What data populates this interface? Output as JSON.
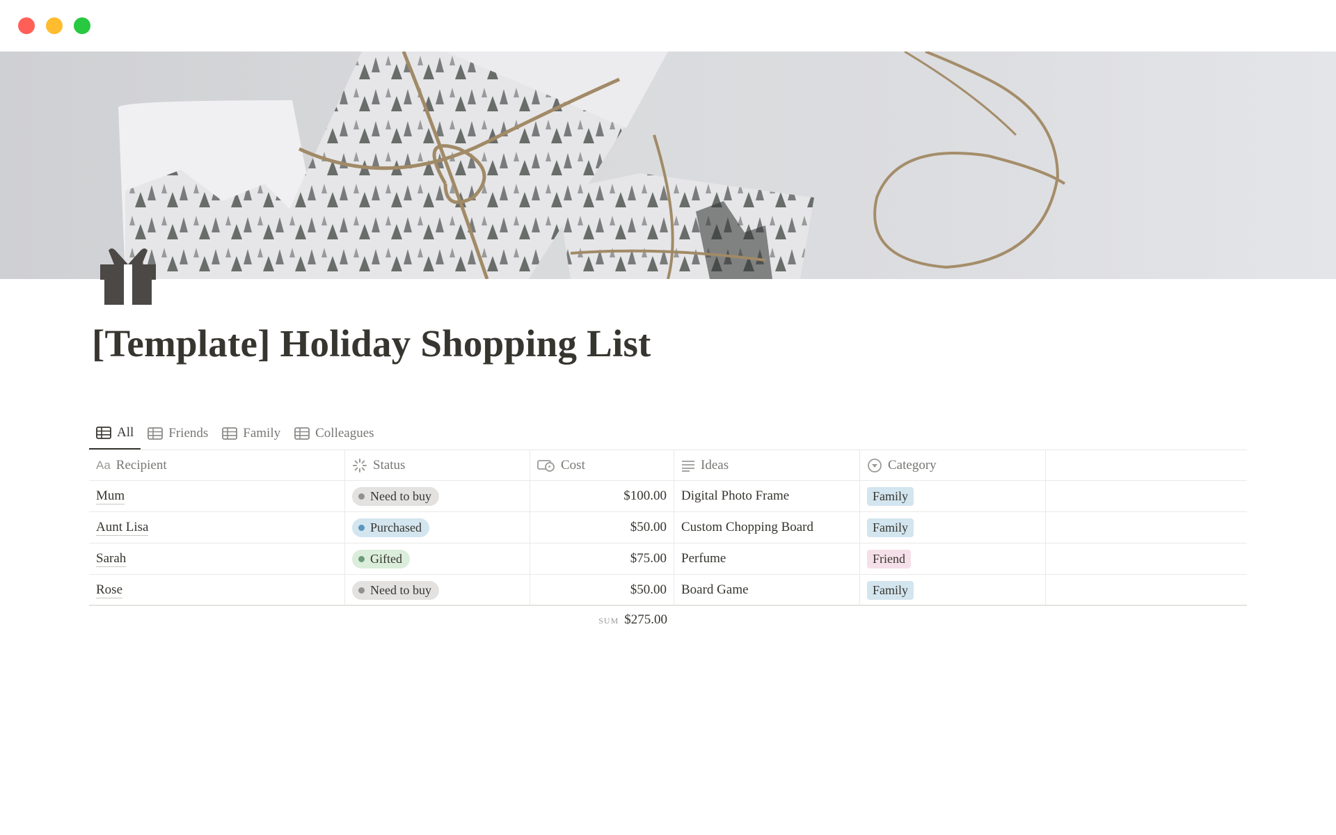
{
  "window": {
    "controls": [
      "close",
      "minimize",
      "maximize"
    ]
  },
  "page": {
    "title": "[Template] Holiday Shopping List",
    "icon": "gift-icon"
  },
  "tabs": [
    {
      "label": "All",
      "icon": "table-icon",
      "active": true
    },
    {
      "label": "Friends",
      "icon": "table-icon",
      "active": false
    },
    {
      "label": "Family",
      "icon": "table-icon",
      "active": false
    },
    {
      "label": "Colleagues",
      "icon": "table-icon",
      "active": false
    }
  ],
  "table": {
    "columns": [
      {
        "label": "Recipient",
        "icon": "text-property-icon"
      },
      {
        "label": "Status",
        "icon": "status-property-icon"
      },
      {
        "label": "Cost",
        "icon": "number-property-icon"
      },
      {
        "label": "Ideas",
        "icon": "list-property-icon"
      },
      {
        "label": "Category",
        "icon": "select-property-icon"
      }
    ],
    "rows": [
      {
        "recipient": "Mum",
        "status": "Need to buy",
        "cost": "$100.00",
        "ideas": "Digital Photo Frame",
        "category": "Family"
      },
      {
        "recipient": "Aunt Lisa",
        "status": "Purchased",
        "cost": "$50.00",
        "ideas": "Custom Chopping Board",
        "category": "Family"
      },
      {
        "recipient": "Sarah",
        "status": "Gifted",
        "cost": "$75.00",
        "ideas": "Perfume",
        "category": "Friend"
      },
      {
        "recipient": "Rose",
        "status": "Need to buy",
        "cost": "$50.00",
        "ideas": "Board Game",
        "category": "Family"
      }
    ],
    "sum_label": "SUM",
    "sum_value": "$275.00"
  },
  "colors": {
    "status": {
      "Need to buy": {
        "bg": "#e3e2e0",
        "dot": "#91918e"
      },
      "Purchased": {
        "bg": "#d3e5ef",
        "dot": "#5b97bd"
      },
      "Gifted": {
        "bg": "#dbeddb",
        "dot": "#6c9b7d"
      }
    },
    "category": {
      "Family": "#d3e5ef",
      "Friend": "#f5e0e9"
    }
  }
}
